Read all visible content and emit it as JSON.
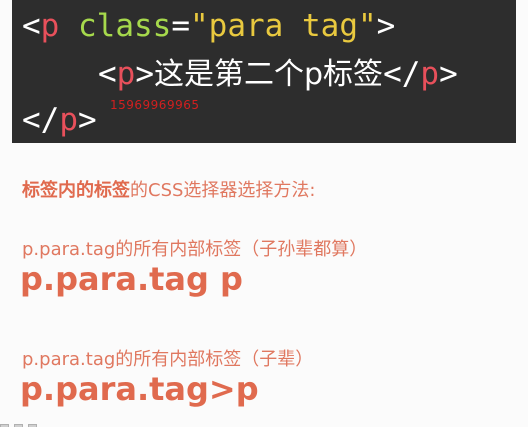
{
  "code": {
    "line1": {
      "open": "<",
      "tag": "p",
      "attr": "class",
      "eq": "=",
      "value": "\"para tag\"",
      "close": ">"
    },
    "line2": {
      "open_lt": "<",
      "open_tag": "p",
      "open_gt": ">",
      "text": "这是第二个p标签",
      "close_lt": "</",
      "close_tag": "p",
      "close_gt": ">"
    },
    "line3": {
      "open": "</",
      "tag": "p",
      "close": ">"
    }
  },
  "watermark": "15969969965",
  "heading": {
    "strong": "标签内的标签",
    "rest": "的CSS选择器选择方法:"
  },
  "rule1": {
    "desc": "p.para.tag的所有内部标签（子孙辈都算）",
    "selector": "p.para.tag p"
  },
  "rule2": {
    "desc": "p.para.tag的所有内部标签（子辈）",
    "selector": "p.para.tag>p"
  },
  "colors": {
    "code_bg": "#2d2d2d",
    "tag": "#e8505b",
    "attr": "#a6d94c",
    "string": "#e9c93f",
    "accent": "#e06a4e"
  }
}
